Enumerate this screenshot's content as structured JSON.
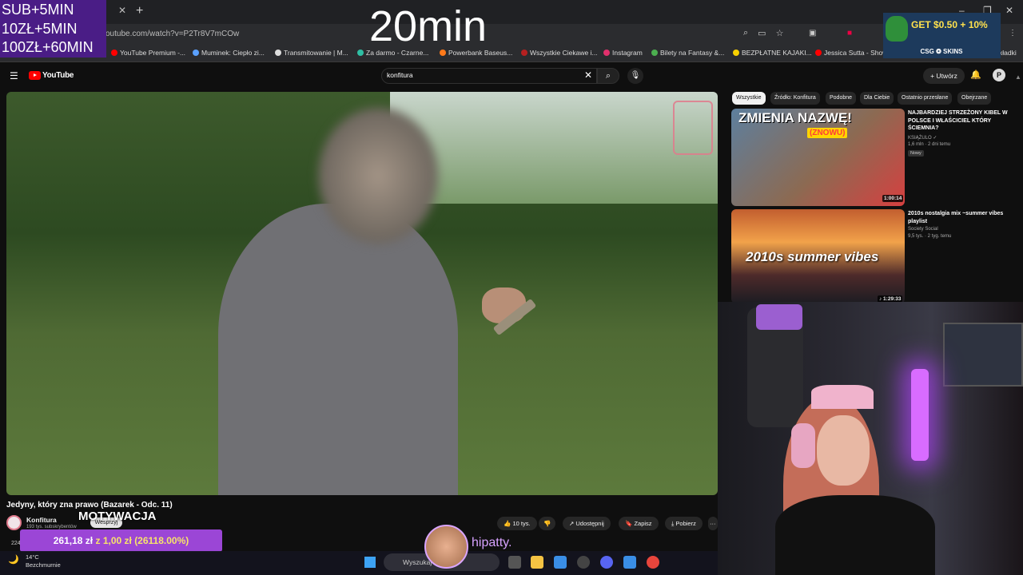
{
  "overlay": {
    "sub_rules": [
      "SUB+5MIN",
      "10ZŁ+5MIN",
      "100ZŁ+60MIN"
    ],
    "timer": "20min",
    "ad_headline": "GET $0.50 + 10%",
    "ad_sub": "CSG ❂ SKINS",
    "hipatty": "hipatty."
  },
  "browser": {
    "url": "outube.com/watch?v=P2Tr8V7mCOw",
    "tab_close": "✕",
    "new_tab": "+",
    "bookmarks": [
      {
        "label": "YouTube Premium -...",
        "color": "#ff0000"
      },
      {
        "label": "Muminek: Ciepło zi...",
        "color": "#5aa0ff"
      },
      {
        "label": "Transmitowanie | M...",
        "color": "#dddddd"
      },
      {
        "label": "Za darmo - Czarne...",
        "color": "#2fbfa4"
      },
      {
        "label": "Powerbank Baseus...",
        "color": "#ff7a1a"
      },
      {
        "label": "Wszystkie Ciekawe i...",
        "color": "#b52020"
      },
      {
        "label": "Instagram",
        "color": "#e1306c"
      },
      {
        "label": "Bilety na Fantasy &...",
        "color": "#4caf50"
      },
      {
        "label": "BEZPŁATNE KAJAKI...",
        "color": "#f7d000"
      },
      {
        "label": "Jessica Sutta - Show...",
        "color": "#ff0000"
      },
      {
        "label": "kładki",
        "color": "#2b2c2f"
      }
    ]
  },
  "youtube": {
    "logo": "YouTube",
    "search_query": "konfitura",
    "create_label": "+ Utwórz",
    "profile_initial": "P"
  },
  "video": {
    "title": "Jedyny, który zna prawo (Bazarek - Odc. 11)",
    "channel": "Konfitura",
    "subs": "193 tys. subskrybentów",
    "support": "Wesprzyj",
    "motivation": "MOTYWACJA",
    "likes": "10 tys.",
    "share": "Udostępnij",
    "save": "Zapisz",
    "download": "Pobierz",
    "more": "···",
    "small_count": "224"
  },
  "donation": {
    "raised": "261,18 zł",
    "separator": "z",
    "goal": "1,00 zł",
    "percent": "(26118.00%)"
  },
  "sidebar": {
    "chips": [
      "Wszystkie",
      "Źródło: Konfitura",
      "Podobne",
      "Dla Ciebie",
      "Ostatnio przesłane",
      "Obejrzane"
    ],
    "videos": [
      {
        "thumb_text": "ZMIENIA NAZWĘ!",
        "thumb_tag": "(ZNOWU)",
        "duration": "1:00:14",
        "title": "NAJBARDZIEJ STRZEŻONY KIBEL W POLSCE I WŁAŚCICIEL KTÓRY ŚCIEMNIA?",
        "channel": "KSIĄŻULO ✓",
        "meta": "1,6 mln · 2 dni temu",
        "badge": "Nowy"
      },
      {
        "thumb_text": "2010s summer vibes",
        "duration": "♪ 1:29:33",
        "title": "2010s nostalgia mix ~summer vibes playlist",
        "channel": "Society Social",
        "meta": "9,5 tys. · 2 tyg. temu"
      }
    ]
  },
  "taskbar": {
    "temp": "14°C",
    "weather": "Bezchmurnie",
    "search_placeholder": "Wyszukaj"
  }
}
